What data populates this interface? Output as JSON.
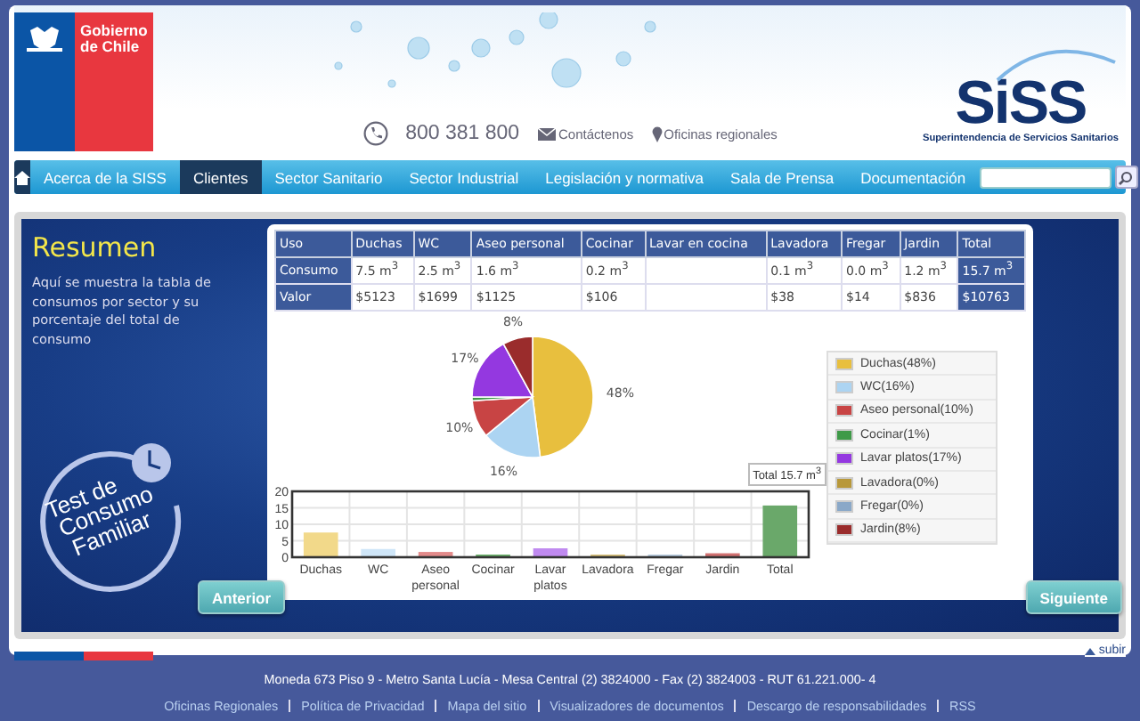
{
  "header": {
    "gov_logo": "Gobierno de Chile",
    "phone": "800 381 800",
    "contact_link": "Contáctenos",
    "offices_link": "Oficinas regionales",
    "brand": "SiSS",
    "brand_subtitle": "Superintendencia de Servicios Sanitarios"
  },
  "nav": {
    "items": [
      {
        "label": "Acerca de la SISS",
        "selected": false
      },
      {
        "label": "Clientes",
        "selected": true
      },
      {
        "label": "Sector Sanitario",
        "selected": false
      },
      {
        "label": "Sector Industrial",
        "selected": false
      },
      {
        "label": "Legislación y normativa",
        "selected": false
      },
      {
        "label": "Sala de Prensa",
        "selected": false
      },
      {
        "label": "Documentación",
        "selected": false
      }
    ]
  },
  "summary": {
    "title": "Resumen",
    "description": "Aquí se muestra la tabla de consumos por sector y su porcentaje del total de consumo",
    "logo_lines": [
      "Test de",
      "Consumo",
      "Familiar"
    ]
  },
  "table": {
    "columns": [
      "Uso",
      "Duchas",
      "WC",
      "Aseo personal",
      "Cocinar",
      "Lavar en cocina",
      "Lavadora",
      "Fregar",
      "Jardin",
      "Total"
    ],
    "rows": [
      [
        "Consumo",
        "7.5 m$^{3}$",
        "2.5 m$^{3}$",
        "1.6 m$^{3}$",
        "0.2 m$^{3}$",
        "",
        "0.1 m$^{3}$",
        "0.0 m$^{3}$",
        "1.2 m$^{3}$",
        "15.7 m$^{3}$"
      ],
      [
        "Valor",
        "$5123",
        "$1699",
        "$1125",
        "$106",
        "",
        "$38",
        "$14",
        "$836",
        "$10763"
      ]
    ]
  },
  "pie": {
    "chart_data": {
      "type": "pie",
      "categories": [
        "Duchas(48%)",
        "WC(16%)",
        "Aseo personal(10%)",
        "Cocinar(1%)",
        "Lavar platos(17%)",
        "Lavadora(0%)",
        "Fregar(0%)",
        "Jardin(8%)"
      ],
      "values": [
        48,
        16,
        10,
        1,
        17,
        0,
        0,
        8
      ],
      "colors": [
        "#e8bf3e",
        "#acd4f2",
        "#c84444",
        "#3e9a48",
        "#9438e0",
        "#b8983a",
        "#8aa8c8",
        "#9a2c2c"
      ],
      "value_labels": [
        "48%",
        "16%",
        "10%",
        null,
        "17%",
        null,
        null,
        "8%"
      ]
    }
  },
  "bars": {
    "chart_data": {
      "type": "bar",
      "categories": [
        "Duchas",
        "WC",
        "Aseo personal",
        "Cocinar",
        "Lavar platos",
        "Lavadora",
        "Fregar",
        "Jardin",
        "Total"
      ],
      "stacked": true,
      "series": [
        {
          "color": "#f2d98a",
          "values": [
            7.5,
            null,
            null,
            null,
            null,
            null,
            null,
            null,
            null
          ]
        },
        {
          "color": "#cfe6f8",
          "values": [
            null,
            2.5,
            null,
            null,
            null,
            null,
            null,
            null,
            null
          ]
        },
        {
          "color": "#e28a8a",
          "values": [
            null,
            null,
            1.6,
            null,
            null,
            null,
            null,
            null,
            null
          ]
        },
        {
          "color": "#6ab06a",
          "values": [
            null,
            null,
            null,
            0.2,
            null,
            null,
            null,
            null,
            null
          ]
        },
        {
          "color": "#c08af0",
          "values": [
            null,
            null,
            null,
            null,
            2.7,
            null,
            null,
            null,
            null
          ]
        },
        {
          "color": "#d8c07a",
          "values": [
            null,
            null,
            null,
            null,
            null,
            0.1,
            null,
            null,
            null
          ]
        },
        {
          "color": "#b8cce0",
          "values": [
            null,
            null,
            null,
            null,
            null,
            null,
            0.0,
            null,
            null
          ]
        },
        {
          "color": "#d07070",
          "values": [
            null,
            null,
            null,
            null,
            null,
            null,
            null,
            1.2,
            null
          ]
        },
        {
          "color": "#6aa86a",
          "values": [
            null,
            null,
            null,
            null,
            null,
            null,
            null,
            null,
            15.7
          ]
        }
      ],
      "ylim": [
        0,
        20
      ],
      "yticks": [
        0,
        5,
        10,
        15,
        20
      ],
      "grid": true,
      "annotations": [
        {
          "text": "Total 15.7 m$^{3}$"
        }
      ]
    }
  },
  "pager": {
    "previous": "Anterior",
    "next": "Siguiente",
    "top_link": "subir"
  },
  "footer": {
    "address": "Moneda 673 Piso 9 - Metro Santa Lucía - Mesa Central (2) 3824000 - Fax (2) 3824003 - RUT 61.221.000- 4",
    "links": [
      "Oficinas Regionales",
      "Política de Privacidad",
      "Mapa del sitio",
      "Visualizadores de documentos",
      "Descargo de responsabilidades",
      "RSS"
    ]
  }
}
